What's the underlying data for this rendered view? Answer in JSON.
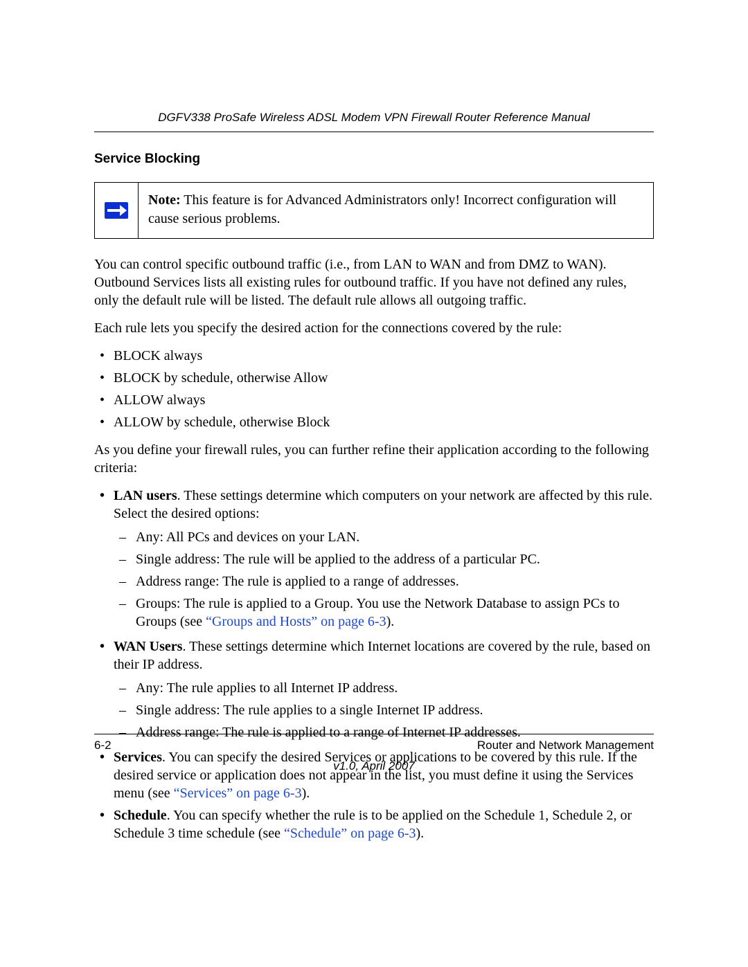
{
  "header": {
    "running_title": "DGFV338 ProSafe Wireless ADSL Modem VPN Firewall Router Reference Manual"
  },
  "section": {
    "heading": "Service Blocking"
  },
  "note": {
    "label": "Note:",
    "text": " This feature is for Advanced Administrators only! Incorrect configuration will cause serious problems."
  },
  "paragraphs": {
    "intro": "You can control specific outbound traffic (i.e., from LAN to WAN and from DMZ to WAN). Outbound Services lists all existing rules for outbound traffic. If you have not defined any rules, only the default rule will be listed. The default rule allows all outgoing traffic.",
    "rule_lead": "Each rule lets you specify the desired action for the connections covered by the rule:",
    "refine_lead": "As you define your firewall rules, you can further refine their application according to the following criteria:"
  },
  "actions": [
    "BLOCK always",
    "BLOCK by schedule, otherwise Allow",
    "ALLOW always",
    "ALLOW by schedule, otherwise Block"
  ],
  "criteria": {
    "lan": {
      "term": "LAN users",
      "desc": ". These settings determine which computers on your network are affected by this rule. Select the desired options:",
      "items": {
        "any": "Any: All PCs and devices on your LAN.",
        "single": "Single address: The rule will be applied to the address of a particular PC.",
        "range": "Address range: The rule is applied to a range of addresses.",
        "groups_pre": "Groups: The rule is applied to a Group. You use the Network Database to assign PCs to Groups (see ",
        "groups_link": "“Groups and Hosts” on page 6-3",
        "groups_post": ")."
      }
    },
    "wan": {
      "term": "WAN Users",
      "desc": ". These settings determine which Internet locations are covered by the rule, based on their IP address.",
      "items": {
        "any": "Any: The rule applies to all Internet IP address.",
        "single": "Single address: The rule applies to a single Internet IP address.",
        "range": "Address range: The rule is applied to a range of Internet IP addresses."
      }
    },
    "services": {
      "term": "Services",
      "pre": ". You can specify the desired Services or applications to be covered by this rule. If the desired service or application does not appear in the list, you must define it using the Services menu (see ",
      "link": "“Services” on page 6-3",
      "post": ")."
    },
    "schedule": {
      "term": "Schedule",
      "pre": ". You can specify whether the rule is to be applied on the Schedule 1, Schedule 2, or Schedule 3 time schedule (see ",
      "link": "“Schedule” on page 6-3",
      "post": ")."
    }
  },
  "footer": {
    "page_num": "6-2",
    "section_name": "Router and Network Management",
    "version": "v1.0, April 2007"
  }
}
